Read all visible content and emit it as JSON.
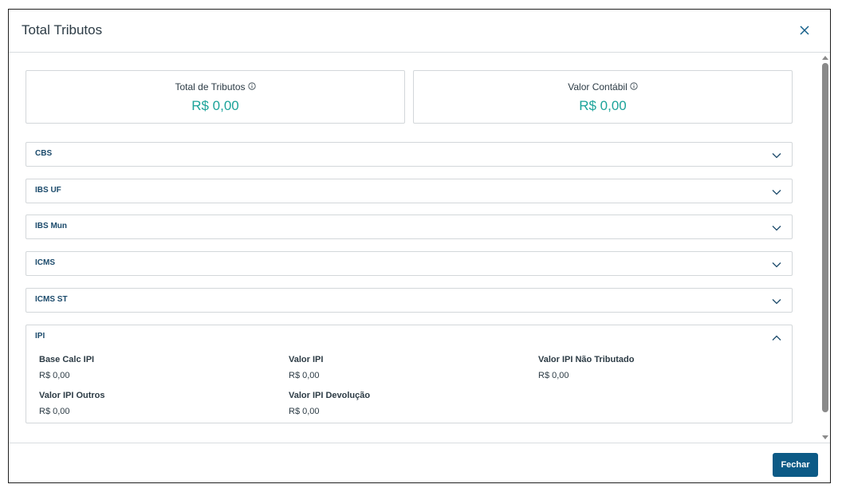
{
  "modal": {
    "title": "Total Tributos",
    "close_icon": "close-icon"
  },
  "summary": {
    "total_tributos": {
      "label": "Total de Tributos",
      "value": "R$ 0,00",
      "icon": "info-icon"
    },
    "valor_contabil": {
      "label": "Valor Contábil",
      "value": "R$ 0,00",
      "icon": "info-icon"
    }
  },
  "sections": [
    {
      "title": "CBS",
      "expanded": false
    },
    {
      "title": "IBS UF",
      "expanded": false
    },
    {
      "title": "IBS Mun",
      "expanded": false
    },
    {
      "title": "ICMS",
      "expanded": false
    },
    {
      "title": "ICMS ST",
      "expanded": false
    },
    {
      "title": "IPI",
      "expanded": true,
      "fields": [
        {
          "label": "Base Calc IPI",
          "value": "R$ 0,00"
        },
        {
          "label": "Valor IPI",
          "value": "R$ 0,00"
        },
        {
          "label": "Valor IPI Não Tributado",
          "value": "R$ 0,00"
        },
        {
          "label": "Valor IPI Outros",
          "value": "R$ 0,00"
        },
        {
          "label": "Valor IPI Devolução",
          "value": "R$ 0,00"
        }
      ]
    }
  ],
  "footer": {
    "close_button": "Fechar"
  },
  "colors": {
    "accent": "#0c5a86",
    "value": "#1ca39a",
    "section_title": "#1b4a6b"
  }
}
